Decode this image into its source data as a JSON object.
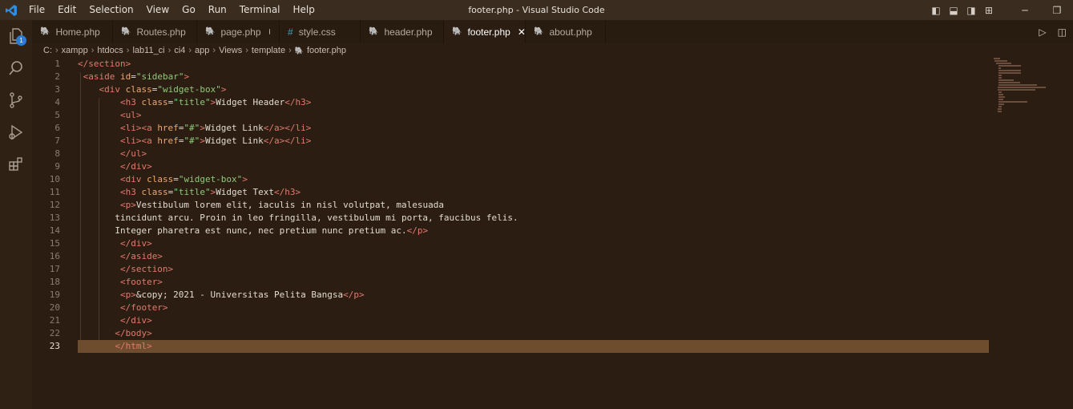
{
  "window": {
    "title": "footer.php - Visual Studio Code"
  },
  "menu": [
    "File",
    "Edit",
    "Selection",
    "View",
    "Go",
    "Run",
    "Terminal",
    "Help"
  ],
  "activity": {
    "badge": "1"
  },
  "tabs": [
    {
      "label": "Home.php",
      "icon": "php-elephant-icon",
      "state": ""
    },
    {
      "label": "Routes.php",
      "icon": "php-elephant-icon",
      "state": ""
    },
    {
      "label": "page.php",
      "icon": "php-elephant-icon",
      "state": "modified"
    },
    {
      "label": "style.css",
      "icon": "css-hash-icon",
      "state": ""
    },
    {
      "label": "header.php",
      "icon": "php-elephant-icon",
      "state": ""
    },
    {
      "label": "footer.php",
      "icon": "php-elephant-icon",
      "state": "active"
    },
    {
      "label": "about.php",
      "icon": "php-elephant-icon",
      "state": ""
    }
  ],
  "breadcrumb": [
    "C:",
    "xampp",
    "htdocs",
    "lab11_ci",
    "ci4",
    "app",
    "Views",
    "template",
    "footer.php"
  ],
  "editor": {
    "current_line": 23,
    "lines": [
      {
        "n": "1",
        "indent": 0,
        "tokens": [
          [
            "tg",
            "</"
          ],
          [
            "tg",
            "section"
          ],
          [
            "tg",
            ">"
          ]
        ]
      },
      {
        "n": "2",
        "indent": 1,
        "tokens": [
          [
            "tg",
            "<aside "
          ],
          [
            "at",
            "id"
          ],
          [
            "tx",
            "="
          ],
          [
            "st",
            "\"sidebar\""
          ],
          [
            "tg",
            ">"
          ]
        ]
      },
      {
        "n": "3",
        "indent": 4,
        "tokens": [
          [
            "tg",
            "<div "
          ],
          [
            "at",
            "class"
          ],
          [
            "tx",
            "="
          ],
          [
            "st",
            "\"widget-box\""
          ],
          [
            "tg",
            ">"
          ]
        ]
      },
      {
        "n": "4",
        "indent": 8,
        "tokens": [
          [
            "tg",
            "<h3 "
          ],
          [
            "at",
            "class"
          ],
          [
            "tx",
            "="
          ],
          [
            "st",
            "\"title\""
          ],
          [
            "tg",
            ">"
          ],
          [
            "tx",
            "Widget Header"
          ],
          [
            "tg",
            "</h3>"
          ]
        ]
      },
      {
        "n": "5",
        "indent": 8,
        "tokens": [
          [
            "tg",
            "<ul>"
          ]
        ]
      },
      {
        "n": "6",
        "indent": 8,
        "tokens": [
          [
            "tg",
            "<li><a "
          ],
          [
            "at",
            "href"
          ],
          [
            "tx",
            "="
          ],
          [
            "st",
            "\"#\""
          ],
          [
            "tg",
            ">"
          ],
          [
            "tx",
            "Widget Link"
          ],
          [
            "tg",
            "</a></li>"
          ]
        ]
      },
      {
        "n": "7",
        "indent": 8,
        "tokens": [
          [
            "tg",
            "<li><a "
          ],
          [
            "at",
            "href"
          ],
          [
            "tx",
            "="
          ],
          [
            "st",
            "\"#\""
          ],
          [
            "tg",
            ">"
          ],
          [
            "tx",
            "Widget Link"
          ],
          [
            "tg",
            "</a></li>"
          ]
        ]
      },
      {
        "n": "8",
        "indent": 8,
        "tokens": [
          [
            "tg",
            "</ul>"
          ]
        ]
      },
      {
        "n": "9",
        "indent": 8,
        "tokens": [
          [
            "tg",
            "</div>"
          ]
        ]
      },
      {
        "n": "10",
        "indent": 8,
        "tokens": [
          [
            "tg",
            "<div "
          ],
          [
            "at",
            "class"
          ],
          [
            "tx",
            "="
          ],
          [
            "st",
            "\"widget-box\""
          ],
          [
            "tg",
            ">"
          ]
        ]
      },
      {
        "n": "11",
        "indent": 8,
        "tokens": [
          [
            "tg",
            "<h3 "
          ],
          [
            "at",
            "class"
          ],
          [
            "tx",
            "="
          ],
          [
            "st",
            "\"title\""
          ],
          [
            "tg",
            ">"
          ],
          [
            "tx",
            "Widget Text"
          ],
          [
            "tg",
            "</h3>"
          ]
        ]
      },
      {
        "n": "12",
        "indent": 8,
        "tokens": [
          [
            "tg",
            "<p>"
          ],
          [
            "tx",
            "Vestibulum lorem elit, iaculis in nisl volutpat, malesuada"
          ]
        ]
      },
      {
        "n": "13",
        "indent": 7,
        "tokens": [
          [
            "tx",
            "tincidunt arcu. Proin in leo fringilla, vestibulum mi porta, faucibus felis."
          ]
        ]
      },
      {
        "n": "14",
        "indent": 7,
        "tokens": [
          [
            "tx",
            "Integer pharetra est nunc, nec pretium nunc pretium ac."
          ],
          [
            "tg",
            "</p>"
          ]
        ]
      },
      {
        "n": "15",
        "indent": 8,
        "tokens": [
          [
            "tg",
            "</div>"
          ]
        ]
      },
      {
        "n": "16",
        "indent": 8,
        "tokens": [
          [
            "tg",
            "</aside>"
          ]
        ]
      },
      {
        "n": "17",
        "indent": 8,
        "tokens": [
          [
            "tg",
            "</section>"
          ]
        ]
      },
      {
        "n": "18",
        "indent": 8,
        "tokens": [
          [
            "tg",
            "<footer>"
          ]
        ]
      },
      {
        "n": "19",
        "indent": 8,
        "tokens": [
          [
            "tg",
            "<p>"
          ],
          [
            "tx",
            "&copy; 2021 - Universitas Pelita Bangsa"
          ],
          [
            "tg",
            "</p>"
          ]
        ]
      },
      {
        "n": "20",
        "indent": 8,
        "tokens": [
          [
            "tg",
            "</footer>"
          ]
        ]
      },
      {
        "n": "21",
        "indent": 8,
        "tokens": [
          [
            "tg",
            "</div>"
          ]
        ]
      },
      {
        "n": "22",
        "indent": 7,
        "tokens": [
          [
            "tg",
            "</body>"
          ]
        ]
      },
      {
        "n": "23",
        "indent": 7,
        "tokens": [
          [
            "tg",
            "</html>"
          ]
        ]
      }
    ]
  }
}
